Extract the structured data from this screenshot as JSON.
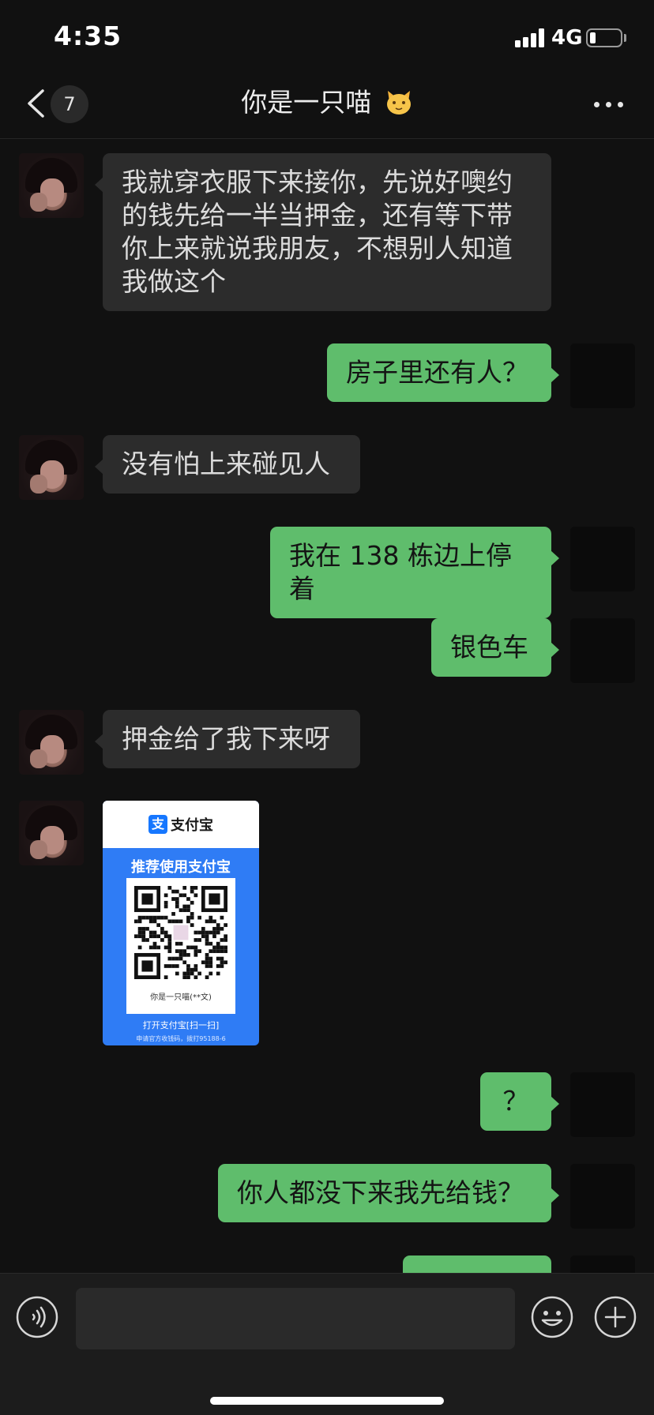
{
  "status_bar": {
    "time": "4:35",
    "network": "4G",
    "battery_level": 0.2
  },
  "nav": {
    "back_icon": "chevron-left-icon",
    "unread_count": "7",
    "title": "你是一只喵",
    "title_emoji": "cat-face-icon",
    "more_icon": "ellipsis-icon"
  },
  "messages": [
    {
      "from": "other",
      "text": "我就穿衣服下来接你，先说好噢约\n的钱先给一半当押金，还有等下带\n你上来就说我朋友，不想别人知道\n我做这个"
    },
    {
      "from": "me",
      "text": "房子里还有人？"
    },
    {
      "from": "other",
      "text": "没有怕上来碰见人"
    },
    {
      "from": "me",
      "text": "我在 138 栋边上停着"
    },
    {
      "from": "me",
      "text": "银色车"
    },
    {
      "from": "other",
      "text": "押金给了我下来呀"
    },
    {
      "from": "other",
      "type": "alipay-qr"
    },
    {
      "from": "me",
      "text": "？"
    },
    {
      "from": "me",
      "text": "你人都没下来我先给钱？"
    }
  ],
  "alipay_card": {
    "brand": "支付宝",
    "logo_glyph": "支",
    "recommend": "推荐使用支付宝",
    "payee": "你是一只喵(**文)",
    "open_hint": "打开支付宝[扫一扫]",
    "hotline": "申请官方收钱码，拨打95188-6"
  },
  "input_bar": {
    "voice_icon": "voice-icon",
    "emoji_icon": "smiley-icon",
    "plus_icon": "plus-circle-icon",
    "placeholder": ""
  },
  "colors": {
    "background": "#111111",
    "bubble_in": "#2c2c2c",
    "bubble_out": "#5fbd6c",
    "alipay_blue": "#2f7cf5"
  }
}
